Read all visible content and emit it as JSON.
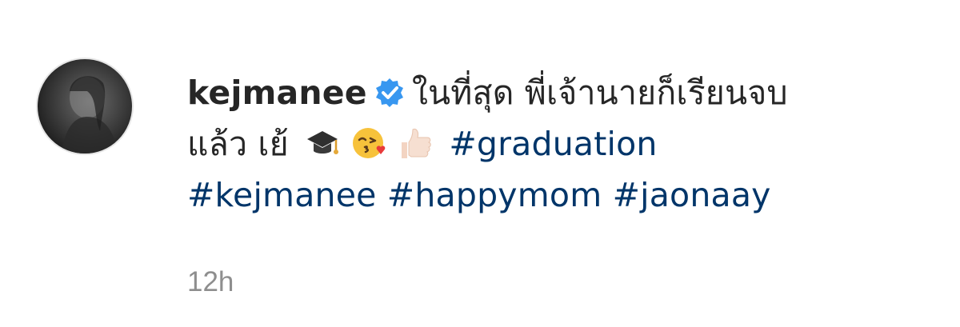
{
  "comment": {
    "username": "kejmanee",
    "verified_icon": "verified-badge-icon",
    "caption_line1": "ในที่สุด พี่เจ้านายก็เรียนจบ",
    "caption_line2": "แล้ว เย้",
    "emojis": [
      "graduation-cap-icon",
      "kissing-face-with-heart-icon",
      "thumbs-up-icon"
    ],
    "hashtags": [
      "#graduation",
      "#kejmanee",
      "#happymom",
      "#jaonaay"
    ],
    "timestamp": "12h",
    "colors": {
      "text": "#262626",
      "hashtag": "#003569",
      "verified": "#3897f0",
      "timestamp": "#8e8e8e"
    }
  }
}
